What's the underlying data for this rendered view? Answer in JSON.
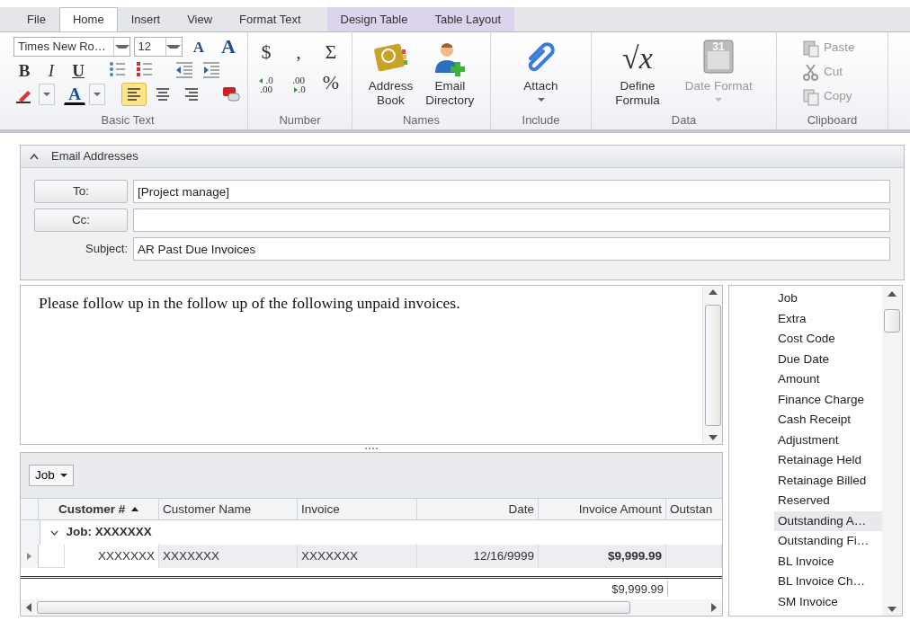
{
  "tabs": [
    {
      "label": "File",
      "selected": false,
      "contextual": false
    },
    {
      "label": "Home",
      "selected": true,
      "contextual": false
    },
    {
      "label": "Insert",
      "selected": false,
      "contextual": false
    },
    {
      "label": "View",
      "selected": false,
      "contextual": false
    },
    {
      "label": "Format Text",
      "selected": false,
      "contextual": false
    },
    {
      "label": "Design Table",
      "selected": false,
      "contextual": true
    },
    {
      "label": "Table Layout",
      "selected": false,
      "contextual": true
    }
  ],
  "ribbon": {
    "basic_text": {
      "label": "Basic Text",
      "font_name": "Times New Ro…",
      "font_size": "12",
      "font_size_buttons": [
        {
          "kind": "grow",
          "glyph": "A"
        },
        {
          "kind": "shrink",
          "glyph": "A"
        }
      ],
      "style_buttons": [
        {
          "kind": "bold",
          "glyph": "B"
        },
        {
          "kind": "italic",
          "glyph": "I"
        },
        {
          "kind": "underline",
          "glyph": "U"
        }
      ],
      "list_buttons": [
        {
          "kind": "bullets"
        },
        {
          "kind": "numbering"
        },
        {
          "kind": "outdent"
        },
        {
          "kind": "indent"
        }
      ],
      "font_color_glyph": "A",
      "align_buttons": [
        {
          "kind": "left",
          "selected": true
        },
        {
          "kind": "center",
          "selected": false
        },
        {
          "kind": "right",
          "selected": false
        }
      ]
    },
    "number": {
      "label": "Number",
      "symbols": [
        "$",
        ",",
        "Σ"
      ],
      "decimal_buttons": [
        {
          "kind": "increase",
          "top": ".0",
          "bottom": ".00"
        },
        {
          "kind": "decrease",
          "top": ".00",
          "bottom": ".0"
        }
      ],
      "percent": "%"
    },
    "groups": [
      {
        "label": "Names",
        "buttons": [
          {
            "kind": "address-book",
            "label": "Address\nBook",
            "disabled": false,
            "dropdown": false
          },
          {
            "kind": "person-add",
            "label": "Email\nDirectory",
            "disabled": false,
            "dropdown": false
          }
        ]
      },
      {
        "label": "Include",
        "buttons": [
          {
            "kind": "paperclip",
            "label": "Attach",
            "disabled": false,
            "dropdown": true
          }
        ]
      },
      {
        "label": "Data",
        "buttons": [
          {
            "kind": "formula",
            "glyph": "√x",
            "label": "Define\nFormula",
            "disabled": false,
            "dropdown": false
          },
          {
            "kind": "calendar",
            "glyph": "31",
            "label": "Date Format",
            "disabled": true,
            "dropdown": true
          }
        ]
      }
    ],
    "clipboard": {
      "label": "Clipboard",
      "buttons": [
        {
          "kind": "paste",
          "label": "Paste",
          "disabled": true
        },
        {
          "kind": "cut",
          "label": "Cut",
          "disabled": true
        },
        {
          "kind": "copy",
          "label": "Copy",
          "disabled": true
        }
      ]
    }
  },
  "email": {
    "title": "Email Addresses",
    "expanded": true,
    "fields": [
      {
        "kind": "button",
        "label": "To:",
        "value": "[Project manage]"
      },
      {
        "kind": "button",
        "label": "Cc:"
      },
      {
        "kind": "text",
        "label": "Subject:",
        "value": "AR Past Due Invoices"
      }
    ]
  },
  "body": {
    "text": "Please follow up in the follow up of the following unpaid invoices."
  },
  "grid": {
    "group_button": "Job",
    "columns": [
      {
        "label": "Customer #",
        "sorted": true
      },
      {
        "label": "Customer Name",
        "sorted": false
      },
      {
        "label": "Invoice",
        "sorted": false
      },
      {
        "label": "Date",
        "sorted": false
      },
      {
        "label": "Invoice Amount",
        "sorted": false
      },
      {
        "label": "Outstan",
        "sorted": false
      }
    ],
    "groups": [
      {
        "label": "Job: XXXXXXX",
        "expanded": true,
        "rows": [
          {
            "cells": [
              "XXXXXXX",
              "XXXXXXX",
              "XXXXXXX",
              "12/16/9999",
              "$9,999.99",
              ""
            ]
          }
        ]
      }
    ],
    "invoice_amount_total": "$9,999.99"
  },
  "field_list": [
    {
      "label": "Job",
      "selected": false
    },
    {
      "label": "Extra",
      "selected": false
    },
    {
      "label": "Cost Code",
      "selected": false
    },
    {
      "label": "Due Date",
      "selected": false
    },
    {
      "label": "Amount",
      "selected": false
    },
    {
      "label": "Finance Charge",
      "selected": false
    },
    {
      "label": "Cash Receipt",
      "selected": false
    },
    {
      "label": "Adjustment",
      "selected": false
    },
    {
      "label": "Retainage Held",
      "selected": false
    },
    {
      "label": "Retainage Billed",
      "selected": false
    },
    {
      "label": "Reserved",
      "selected": false
    },
    {
      "label": "Outstanding A…",
      "selected": true
    },
    {
      "label": "Outstanding Fi…",
      "selected": false
    },
    {
      "label": "BL Invoice",
      "selected": false
    },
    {
      "label": "BL Invoice Ch…",
      "selected": false
    },
    {
      "label": "SM Invoice",
      "selected": false
    }
  ]
}
